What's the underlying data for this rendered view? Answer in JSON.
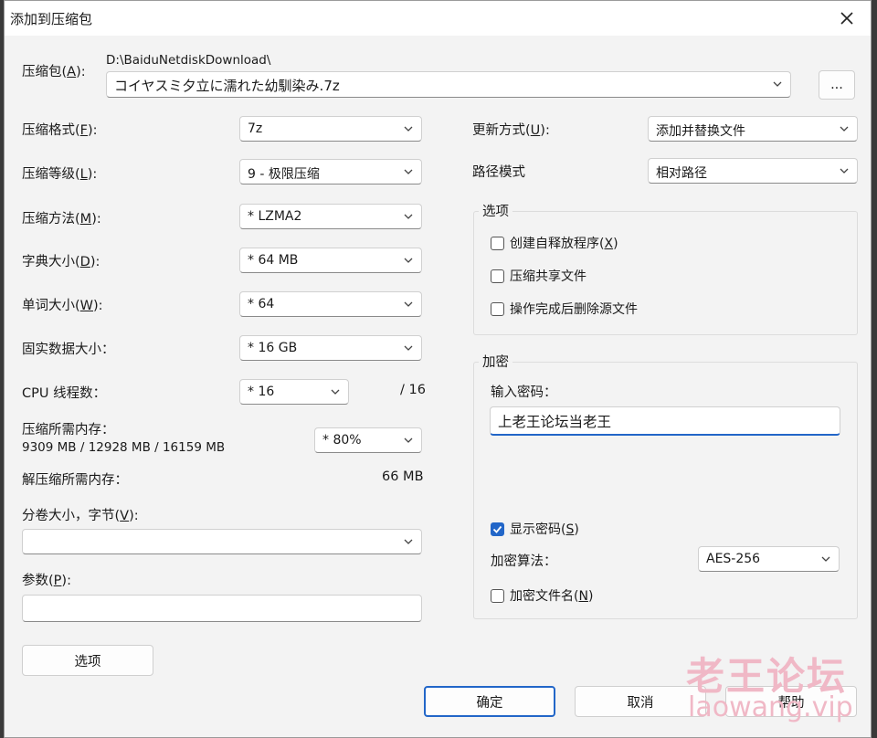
{
  "window": {
    "title": "添加到压缩包"
  },
  "archive": {
    "label_prefix": "压缩包(",
    "label_key": "A",
    "label_suffix": "):",
    "path": "D:\\BaiduNetdiskDownload\\",
    "filename": "コイヤスミ夕立に濡れた幼馴染み.7z",
    "browse_label": "..."
  },
  "left": {
    "format": {
      "label_prefix": "压缩格式(",
      "key": "F",
      "label_suffix": "):",
      "value": "7z"
    },
    "level": {
      "label_prefix": "压缩等级(",
      "key": "L",
      "label_suffix": "):",
      "value": "9 - 极限压缩"
    },
    "method": {
      "label_prefix": "压缩方法(",
      "key": "M",
      "label_suffix": "):",
      "value": "* LZMA2"
    },
    "dict": {
      "label_prefix": "字典大小(",
      "key": "D",
      "label_suffix": "):",
      "value": "* 64 MB"
    },
    "word": {
      "label_prefix": "单词大小(",
      "key": "W",
      "label_suffix": "):",
      "value": "* 64"
    },
    "solid": {
      "label": "固实数据大小：",
      "value": "* 16 GB"
    },
    "threads": {
      "label": "CPU 线程数：",
      "value": "* 16",
      "max": "/ 16"
    },
    "memory": {
      "label": "压缩所需内存：",
      "detail": "9309 MB / 12928 MB / 16159 MB",
      "value": "* 80%"
    },
    "decomp": {
      "label": "解压缩所需内存：",
      "value": "66 MB"
    },
    "volume": {
      "label_prefix": "分卷大小，字节(",
      "key": "V",
      "label_suffix": "):",
      "value": ""
    },
    "params": {
      "label_prefix": "参数(",
      "key": "P",
      "label_suffix": "):",
      "value": ""
    },
    "options_button": "选项"
  },
  "right": {
    "update": {
      "label_prefix": "更新方式(",
      "key": "U",
      "label_suffix": "):",
      "value": "添加并替换文件"
    },
    "path_mode": {
      "label": "路径模式",
      "value": "相对路径"
    },
    "options": {
      "title": "选项",
      "sfx": {
        "label_prefix": "创建自释放程序(",
        "key": "X",
        "label_suffix": ")",
        "checked": false
      },
      "shared": {
        "label": "压缩共享文件",
        "checked": false
      },
      "delete": {
        "label": "操作完成后删除源文件",
        "checked": false
      }
    },
    "encryption": {
      "title": "加密",
      "password_label": "输入密码：",
      "password_value": "上老王论坛当老王",
      "show_prefix": "显示密码(",
      "show_key": "S",
      "show_suffix": ")",
      "show_checked": true,
      "method_label": "加密算法：",
      "method_value": "AES-256",
      "encrypt_names_prefix": "加密文件名(",
      "encrypt_names_key": "N",
      "encrypt_names_suffix": ")",
      "encrypt_names_checked": false
    }
  },
  "buttons": {
    "ok": "确定",
    "cancel": "取消",
    "help": "帮助"
  },
  "watermark": {
    "line1": "老王论坛",
    "line2": "laowang.vip"
  },
  "colors": {
    "accent": "#2266c8",
    "dialog_bg": "#f3f3f3",
    "watermark": "#f0b8c6"
  }
}
